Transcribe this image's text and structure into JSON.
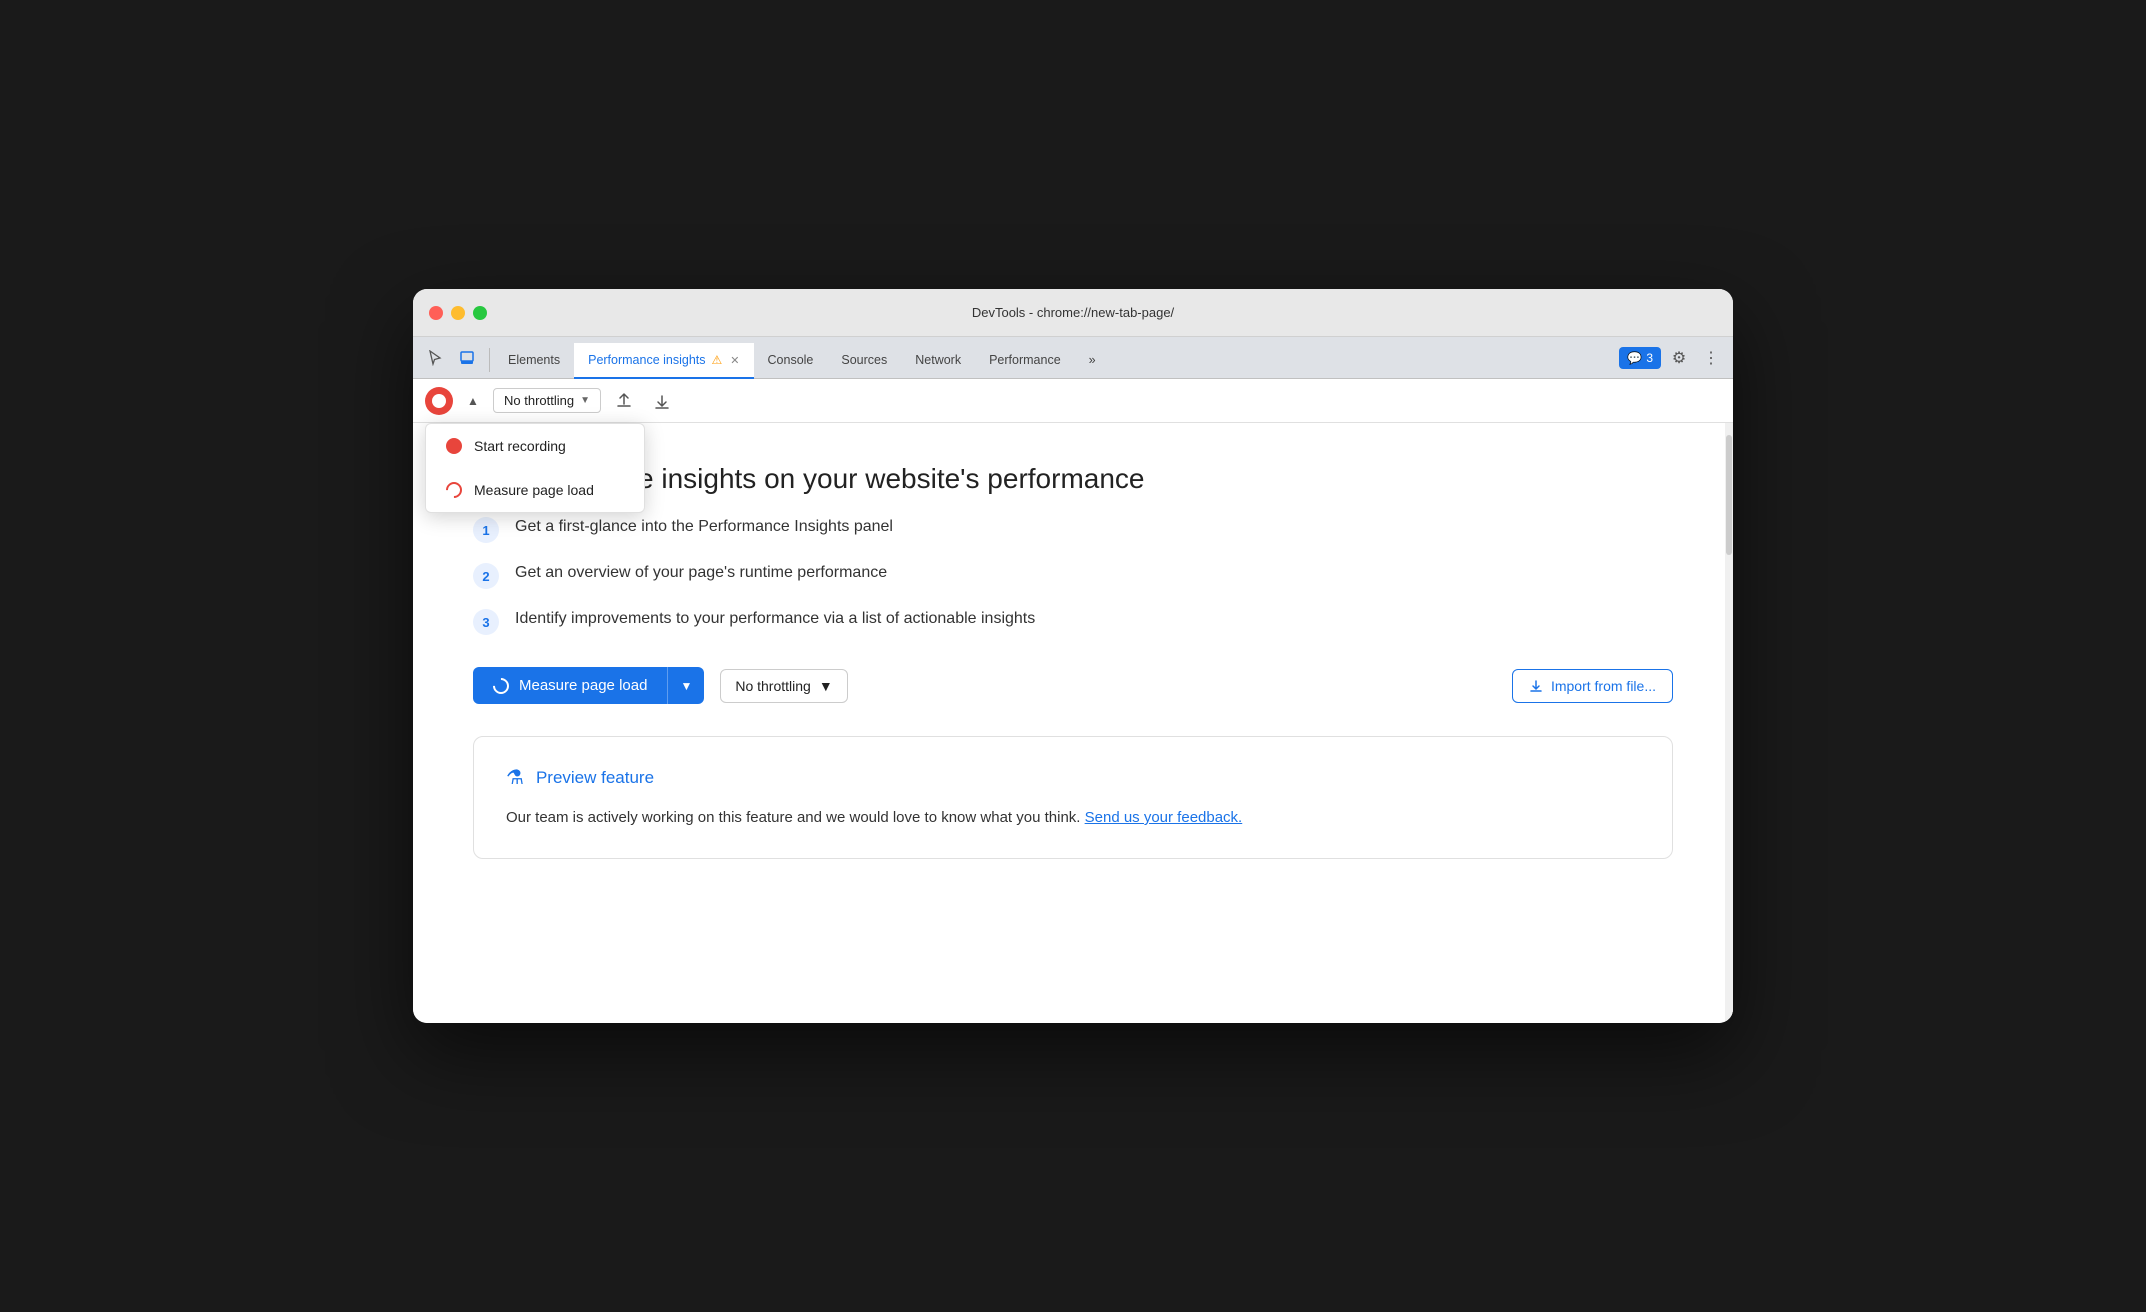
{
  "window": {
    "title": "DevTools - chrome://new-tab-page/"
  },
  "tabs": {
    "items": [
      {
        "id": "elements",
        "label": "Elements",
        "active": false,
        "closeable": false
      },
      {
        "id": "performance-insights",
        "label": "Performance insights",
        "active": true,
        "closeable": true,
        "warning": true
      },
      {
        "id": "console",
        "label": "Console",
        "active": false,
        "closeable": false
      },
      {
        "id": "sources",
        "label": "Sources",
        "active": false,
        "closeable": false
      },
      {
        "id": "network",
        "label": "Network",
        "active": false,
        "closeable": false
      },
      {
        "id": "performance",
        "label": "Performance",
        "active": false,
        "closeable": false
      }
    ],
    "more_label": "»",
    "feedback_label": "3",
    "feedback_icon": "💬"
  },
  "toolbar": {
    "throttle_label": "No throttling",
    "throttle_dropdown_arrow": "▼"
  },
  "dropdown": {
    "start_recording": "Start recording",
    "measure_page_load": "Measure page load"
  },
  "main": {
    "title": "Get actionable insights on your website's performance",
    "steps": [
      {
        "num": "1",
        "text": "Get a first-glance into the Performance Insights panel"
      },
      {
        "num": "2",
        "text": "Get an overview of your page's runtime performance"
      },
      {
        "num": "3",
        "text": "Identify improvements to your performance via a list of actionable insights"
      }
    ],
    "measure_btn": "Measure page load",
    "throttle_btn": "No throttling",
    "import_btn": "Import from file...",
    "preview_feature_label": "Preview feature",
    "preview_text": "Our team is actively working on this feature and we would love to know what you think.",
    "feedback_link": "Send us your feedback."
  }
}
